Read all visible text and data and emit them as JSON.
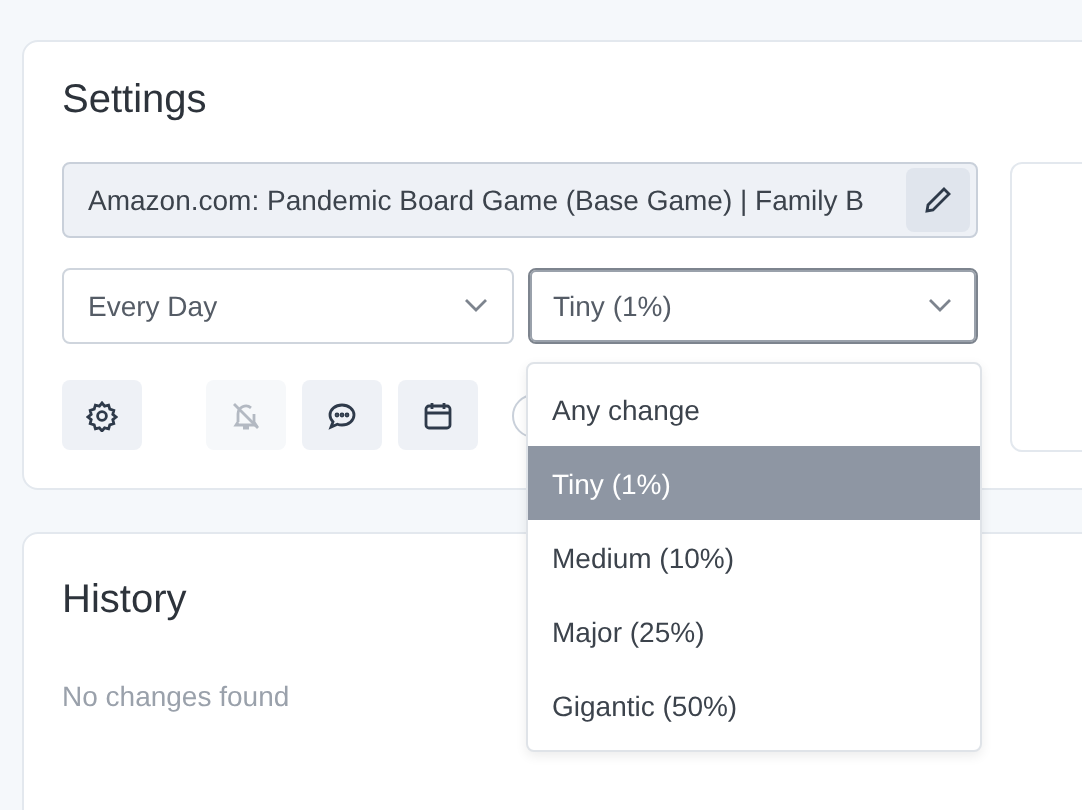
{
  "settings": {
    "title": "Settings",
    "url_field": {
      "value": "Amazon.com: Pandemic Board Game (Base Game) | Family B"
    },
    "frequency_select": {
      "value": "Every Day"
    },
    "threshold_select": {
      "value": "Tiny (1%)",
      "expanded": true,
      "options": [
        {
          "label": "Any change",
          "selected": false
        },
        {
          "label": "Tiny (1%)",
          "selected": true
        },
        {
          "label": "Medium (10%)",
          "selected": false
        },
        {
          "label": "Major (25%)",
          "selected": false
        },
        {
          "label": "Gigantic (50%)",
          "selected": false
        }
      ]
    },
    "icon_buttons": [
      {
        "kind": "gear",
        "disabled": false
      },
      {
        "kind": "bell-off",
        "disabled": true
      },
      {
        "kind": "chat",
        "disabled": false
      },
      {
        "kind": "calendar",
        "disabled": false
      }
    ]
  },
  "history": {
    "title": "History",
    "empty_message": "No changes found"
  }
}
